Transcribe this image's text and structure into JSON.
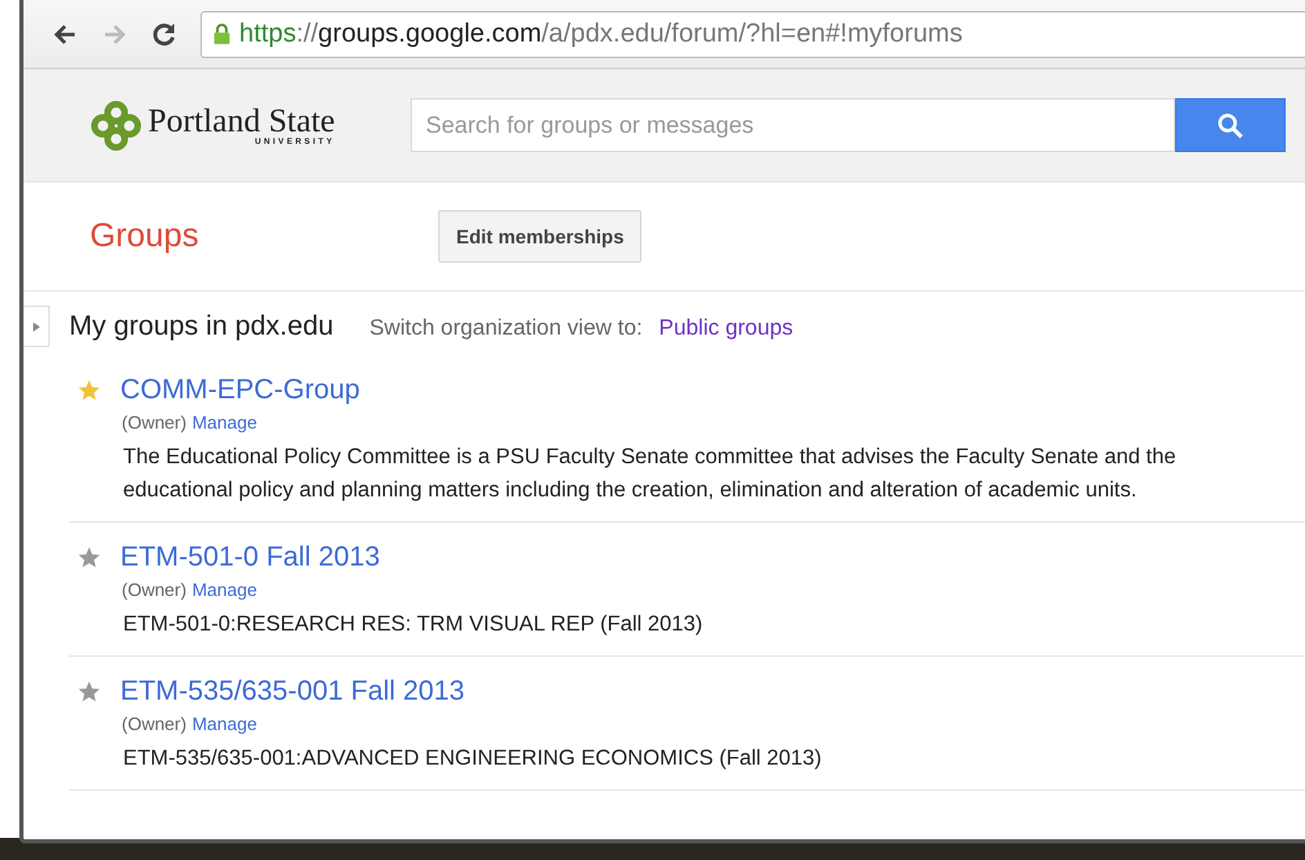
{
  "browser": {
    "url": {
      "scheme": "https",
      "separator": "://",
      "host": "groups.google.com",
      "path": "/a/pdx.edu/forum/?hl=en#!myforums"
    }
  },
  "header": {
    "logo_name": "Portland State",
    "logo_subtitle": "UNIVERSITY",
    "search": {
      "placeholder": "Search for groups or messages"
    }
  },
  "page": {
    "title": "Groups",
    "edit_button": "Edit memberships"
  },
  "section": {
    "heading": "My groups in pdx.edu",
    "switch_label": "Switch organization view to:",
    "switch_link": "Public groups"
  },
  "groups": [
    {
      "name": "COMM-EPC-Group",
      "starred": true,
      "role": "(Owner)",
      "manage": "Manage",
      "description_lines": [
        "The Educational Policy Committee is a PSU Faculty Senate committee that advises the Faculty Senate and the",
        "educational policy and planning matters including the creation, elimination and alteration of academic units."
      ]
    },
    {
      "name": "ETM-501-0 Fall 2013",
      "starred": false,
      "role": "(Owner)",
      "manage": "Manage",
      "description_lines": [
        "ETM-501-0:RESEARCH RES: TRM VISUAL REP (Fall 2013)"
      ]
    },
    {
      "name": "ETM-535/635-001 Fall 2013",
      "starred": false,
      "role": "(Owner)",
      "manage": "Manage",
      "description_lines": [
        "ETM-535/635-001:ADVANCED ENGINEERING ECONOMICS (Fall 2013)"
      ]
    }
  ]
}
